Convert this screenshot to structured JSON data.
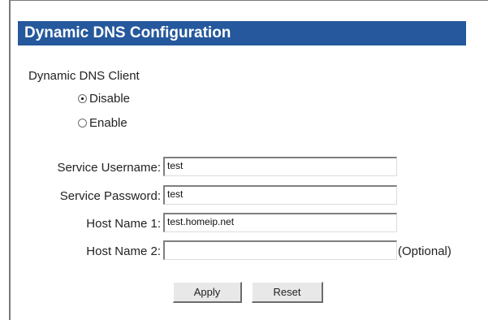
{
  "header": {
    "title": "Dynamic DNS Configuration"
  },
  "client": {
    "label": "Dynamic DNS Client",
    "options": [
      {
        "label": "Disable",
        "checked": true
      },
      {
        "label": "Enable",
        "checked": false
      }
    ]
  },
  "fields": [
    {
      "label": "Service Username:",
      "value": "test"
    },
    {
      "label": "Service Password:",
      "value": "test"
    },
    {
      "label": "Host Name 1:",
      "value": "test.homeip.net"
    },
    {
      "label": "Host Name 2:",
      "value": "",
      "suffix": "(Optional)"
    }
  ],
  "buttons": {
    "apply": "Apply",
    "reset": "Reset"
  },
  "colors": {
    "header_bg": "#25589c",
    "header_text": "#ffffff"
  }
}
